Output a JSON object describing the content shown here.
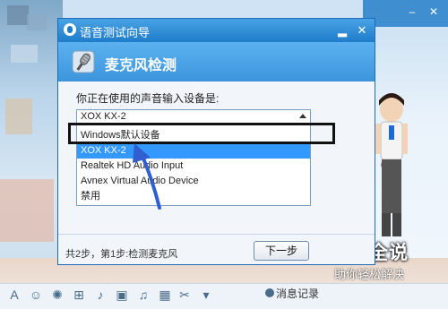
{
  "dialog": {
    "title": "语音测试向导",
    "header_title": "麦克风检测",
    "prompt": "你正在使用的声音输入设备是:",
    "selected_device": "XOX KX-2",
    "options": [
      {
        "label": "Windows默认设备"
      },
      {
        "label": "XOX KX-2"
      },
      {
        "label": "Realtek HD Audio Input"
      },
      {
        "label": "Avnex Virtual Audio Device"
      },
      {
        "label": "禁用"
      }
    ],
    "footer": "共2步，第1步:检测麦克风",
    "next_button": "下一步",
    "minimize": "▂",
    "close": "✕"
  },
  "background": {
    "message_record": "消息记录",
    "window_minimize": "–",
    "window_close": "✕"
  },
  "watermark": {
    "title": "百科全说",
    "subtitle": "助你轻松解决"
  }
}
